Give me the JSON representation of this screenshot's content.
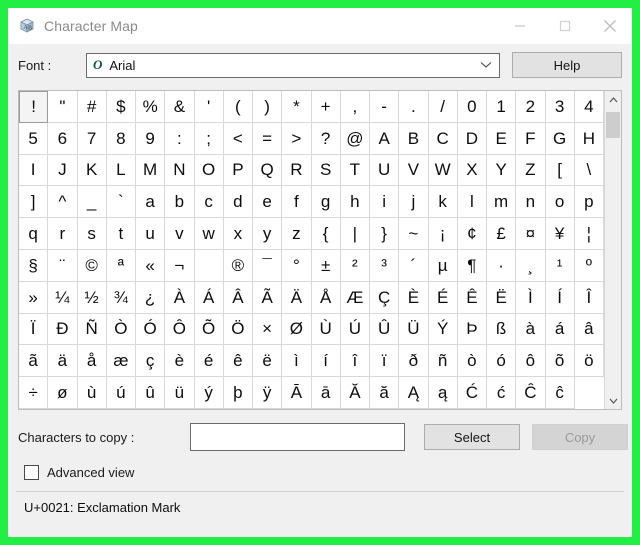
{
  "window": {
    "title": "Character Map",
    "icon": "character-map-icon",
    "controls": {
      "minimize": "minimize-icon",
      "maximize": "maximize-icon",
      "close": "close-icon"
    }
  },
  "font": {
    "label": "Font :",
    "type_icon": "O",
    "selected": "Arial",
    "chevron": "chevron-down-icon"
  },
  "help": {
    "label": "Help"
  },
  "grid": {
    "columns": 20,
    "rows": 10,
    "selected_index": 0,
    "characters": [
      "!",
      "\"",
      "#",
      "$",
      "%",
      "&",
      "'",
      "(",
      ")",
      "*",
      "+",
      ",",
      "-",
      ".",
      "/",
      "0",
      "1",
      "2",
      "3",
      "4",
      "5",
      "6",
      "7",
      "8",
      "9",
      ":",
      ";",
      "<",
      "=",
      ">",
      "?",
      "@",
      "A",
      "B",
      "C",
      "D",
      "E",
      "F",
      "G",
      "H",
      "I",
      "J",
      "K",
      "L",
      "M",
      "N",
      "O",
      "P",
      "Q",
      "R",
      "S",
      "T",
      "U",
      "V",
      "W",
      "X",
      "Y",
      "Z",
      "[",
      "\\",
      "]",
      "^",
      "_",
      "`",
      "a",
      "b",
      "c",
      "d",
      "e",
      "f",
      "g",
      "h",
      "i",
      "j",
      "k",
      "l",
      "m",
      "n",
      "o",
      "p",
      "q",
      "r",
      "s",
      "t",
      "u",
      "v",
      "w",
      "x",
      "y",
      "z",
      "{",
      "|",
      "}",
      "~",
      "¡",
      "¢",
      "£",
      "¤",
      "¥",
      "¦",
      "§",
      "¨",
      "©",
      "ª",
      "«",
      "¬",
      "­",
      "®",
      "¯",
      "°",
      "±",
      "²",
      "³",
      "´",
      "µ",
      "¶",
      "·",
      "¸",
      "¹",
      "º",
      "»",
      "¼",
      "½",
      "¾",
      "¿",
      "À",
      "Á",
      "Â",
      "Ã",
      "Ä",
      "Å",
      "Æ",
      "Ç",
      "È",
      "É",
      "Ê",
      "Ë",
      "Ì",
      "Í",
      "Î",
      "Ï",
      "Ð",
      "Ñ",
      "Ò",
      "Ó",
      "Ô",
      "Õ",
      "Ö",
      "×",
      "Ø",
      "Ù",
      "Ú",
      "Û",
      "Ü",
      "Ý",
      "Þ",
      "ß",
      "à",
      "á",
      "â",
      "ã",
      "ä",
      "å",
      "æ",
      "ç",
      "è",
      "é",
      "ê",
      "ë",
      "ì",
      "í",
      "î",
      "ï",
      "ð",
      "ñ",
      "ò",
      "ó",
      "ô",
      "õ",
      "ö",
      "÷",
      "ø",
      "ù",
      "ú",
      "û",
      "ü",
      "ý",
      "þ",
      "ÿ",
      "Ā",
      "ā",
      "Ă",
      "ă",
      "Ą",
      "ą",
      "Ć",
      "ć",
      "Ĉ",
      "ĉ"
    ],
    "scrollbar": {
      "up_icon": "chevron-up-icon",
      "down_icon": "chevron-down-icon"
    }
  },
  "copy_section": {
    "label": "Characters to copy :",
    "input_value": "",
    "input_placeholder": "",
    "select_label": "Select",
    "copy_label": "Copy",
    "copy_disabled": true
  },
  "advanced": {
    "label": "Advanced view",
    "checked": false
  },
  "status": {
    "text": "U+0021: Exclamation Mark"
  },
  "colors": {
    "border_accent": "#22ee44",
    "window_bg": "#f0f0f0",
    "title_color": "#8b8b8b",
    "font_icon_color": "#0a5c3a"
  }
}
